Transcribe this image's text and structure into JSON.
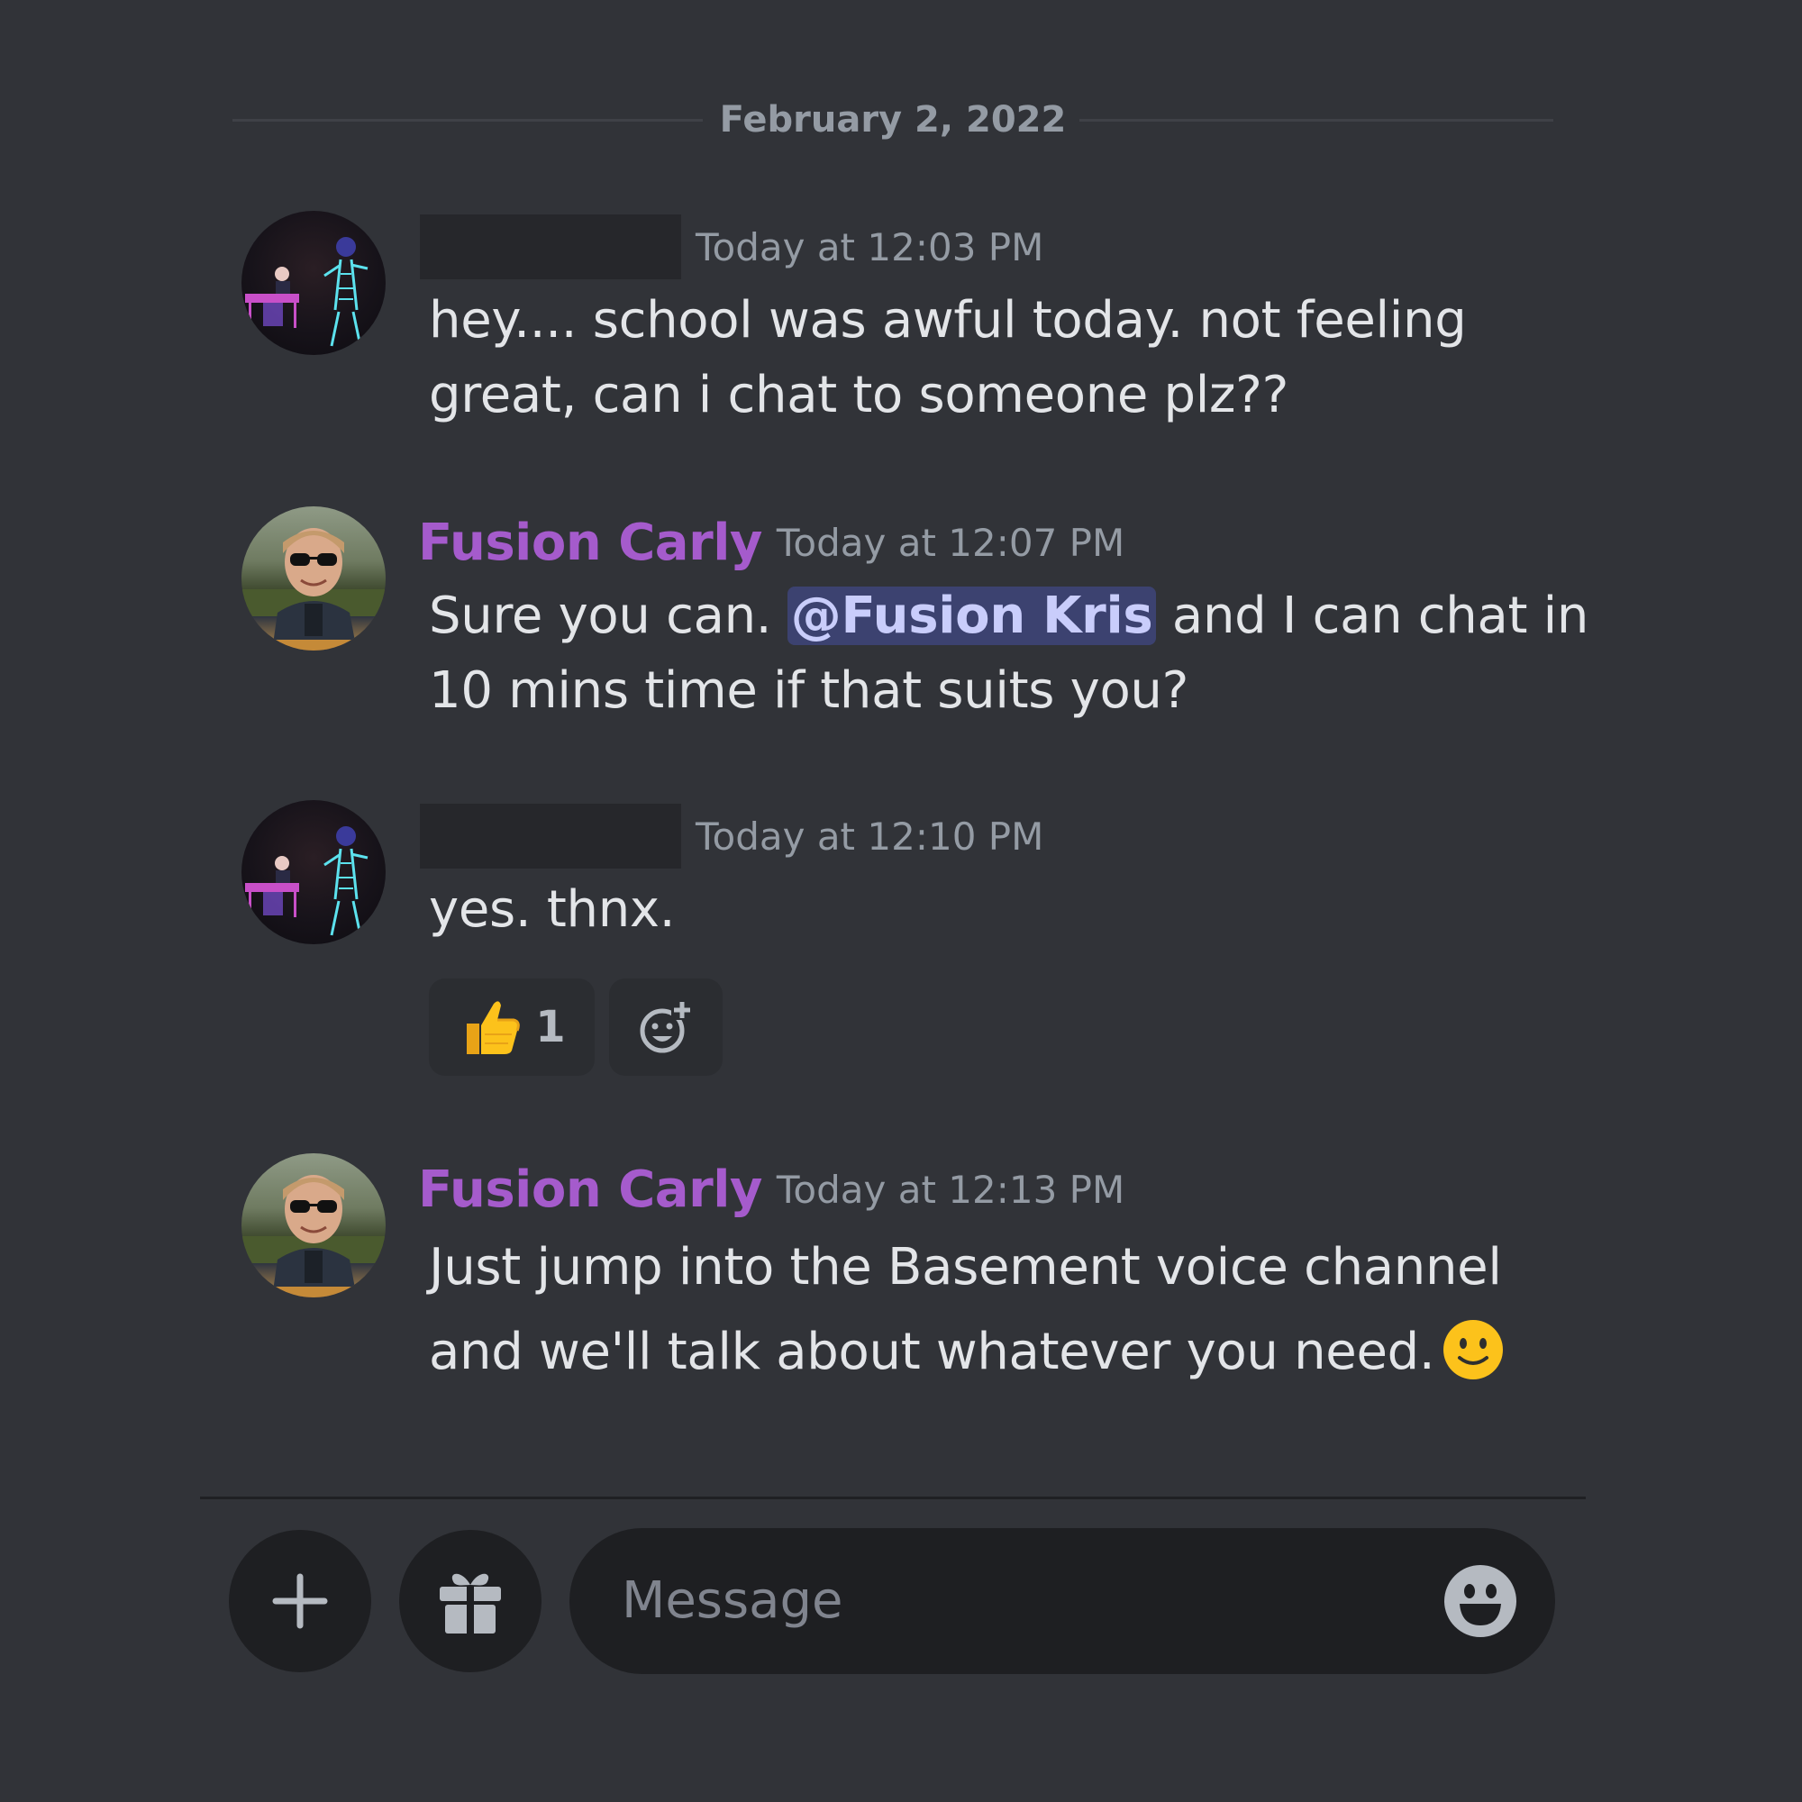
{
  "date_divider": "February 2, 2022",
  "messages": [
    {
      "username": "",
      "timestamp": "Today at 12:03 PM",
      "text": "hey.... school was awful today. not feeling great, can i chat to someone plz??"
    },
    {
      "username": "Fusion Carly",
      "timestamp": "Today at 12:07 PM",
      "text_before": "Sure you can. ",
      "mention": "@Fusion Kris",
      "text_after": " and I can chat in 10 mins time if that suits you?"
    },
    {
      "username": "",
      "timestamp": "Today at 12:10 PM",
      "text": "yes. thnx.",
      "reactions": [
        {
          "emoji": "thumbs-up",
          "count": "1"
        }
      ]
    },
    {
      "username": "Fusion Carly",
      "timestamp": "Today at 12:13 PM",
      "text": "Just jump into the Basement voice channel and we'll talk about whatever you need.",
      "emoji": "slightly-smiling-face"
    }
  ],
  "composer": {
    "placeholder": "Message"
  },
  "colors": {
    "background": "#313338",
    "username": "#a55bcc",
    "mention_bg": "#3c4270",
    "input_bg": "#1e1f22"
  },
  "icons": [
    "plus-icon",
    "gift-icon",
    "emoji-icon",
    "add-reaction-icon",
    "thumbs-up-emoji",
    "slightly-smiling-face-emoji"
  ]
}
